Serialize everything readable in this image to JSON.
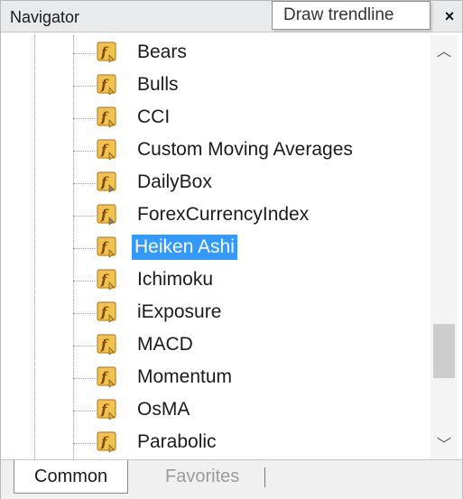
{
  "window": {
    "title": "Navigator",
    "tooltip": "Draw trendline",
    "close_label": "×"
  },
  "list": {
    "items": [
      {
        "label": "Bears",
        "icon": "indicator-f-icon"
      },
      {
        "label": "Bulls",
        "icon": "indicator-f-icon"
      },
      {
        "label": "CCI",
        "icon": "indicator-f-icon"
      },
      {
        "label": "Custom Moving Averages",
        "icon": "indicator-f-icon"
      },
      {
        "label": "DailyBox",
        "icon": "indicator-f-gray-icon"
      },
      {
        "label": "ForexCurrencyIndex",
        "icon": "indicator-f-gray-icon"
      },
      {
        "label": "Heiken Ashi",
        "icon": "indicator-f-icon",
        "selected": true
      },
      {
        "label": "Ichimoku",
        "icon": "indicator-f-icon"
      },
      {
        "label": "iExposure",
        "icon": "indicator-f-icon"
      },
      {
        "label": "MACD",
        "icon": "indicator-f-icon"
      },
      {
        "label": "Momentum",
        "icon": "indicator-f-icon"
      },
      {
        "label": "OsMA",
        "icon": "indicator-f-icon"
      },
      {
        "label": "Parabolic",
        "icon": "indicator-f-icon"
      }
    ]
  },
  "scrollbar": {
    "up_glyph": "︿",
    "down_glyph": "﹀"
  },
  "tabs": [
    {
      "label": "Common",
      "active": true
    },
    {
      "label": "Favorites",
      "active": false
    }
  ],
  "colors": {
    "selection": "#3399ff",
    "icon_fill": "#f2c14e",
    "icon_border": "#b8862b"
  }
}
